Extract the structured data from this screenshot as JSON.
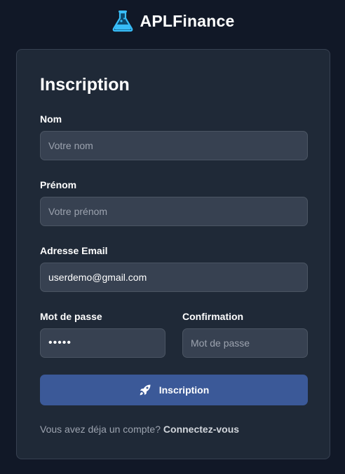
{
  "brand": {
    "name": "APLFinance",
    "logo_icon": "flask-icon",
    "accent_color": "#38bdf8"
  },
  "form": {
    "title": "Inscription",
    "nom": {
      "label": "Nom",
      "placeholder": "Votre nom",
      "value": ""
    },
    "prenom": {
      "label": "Prénom",
      "placeholder": "Votre prénom",
      "value": ""
    },
    "email": {
      "label": "Adresse Email",
      "placeholder": "",
      "value": "userdemo@gmail.com"
    },
    "password": {
      "label": "Mot de passe",
      "placeholder": "",
      "value": "•••••"
    },
    "confirmation": {
      "label": "Confirmation",
      "placeholder": "Mot de passe",
      "value": ""
    },
    "submit": {
      "label": "Inscription",
      "icon": "rocket-icon",
      "color": "#3b5998"
    }
  },
  "footer": {
    "text": "Vous avez déja un compte?",
    "link": "Connectez-vous"
  }
}
